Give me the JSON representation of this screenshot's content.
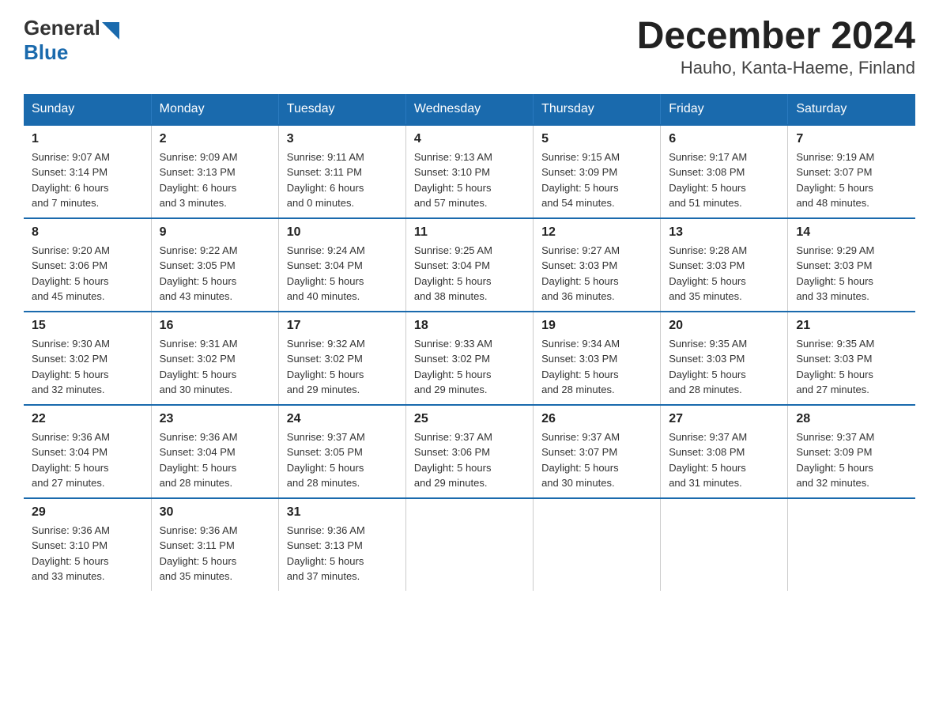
{
  "logo": {
    "general": "General",
    "blue": "Blue"
  },
  "title": "December 2024",
  "subtitle": "Hauho, Kanta-Haeme, Finland",
  "days_of_week": [
    "Sunday",
    "Monday",
    "Tuesday",
    "Wednesday",
    "Thursday",
    "Friday",
    "Saturday"
  ],
  "weeks": [
    [
      {
        "day": "1",
        "sunrise": "9:07 AM",
        "sunset": "3:14 PM",
        "daylight": "6 hours and 7 minutes."
      },
      {
        "day": "2",
        "sunrise": "9:09 AM",
        "sunset": "3:13 PM",
        "daylight": "6 hours and 3 minutes."
      },
      {
        "day": "3",
        "sunrise": "9:11 AM",
        "sunset": "3:11 PM",
        "daylight": "6 hours and 0 minutes."
      },
      {
        "day": "4",
        "sunrise": "9:13 AM",
        "sunset": "3:10 PM",
        "daylight": "5 hours and 57 minutes."
      },
      {
        "day": "5",
        "sunrise": "9:15 AM",
        "sunset": "3:09 PM",
        "daylight": "5 hours and 54 minutes."
      },
      {
        "day": "6",
        "sunrise": "9:17 AM",
        "sunset": "3:08 PM",
        "daylight": "5 hours and 51 minutes."
      },
      {
        "day": "7",
        "sunrise": "9:19 AM",
        "sunset": "3:07 PM",
        "daylight": "5 hours and 48 minutes."
      }
    ],
    [
      {
        "day": "8",
        "sunrise": "9:20 AM",
        "sunset": "3:06 PM",
        "daylight": "5 hours and 45 minutes."
      },
      {
        "day": "9",
        "sunrise": "9:22 AM",
        "sunset": "3:05 PM",
        "daylight": "5 hours and 43 minutes."
      },
      {
        "day": "10",
        "sunrise": "9:24 AM",
        "sunset": "3:04 PM",
        "daylight": "5 hours and 40 minutes."
      },
      {
        "day": "11",
        "sunrise": "9:25 AM",
        "sunset": "3:04 PM",
        "daylight": "5 hours and 38 minutes."
      },
      {
        "day": "12",
        "sunrise": "9:27 AM",
        "sunset": "3:03 PM",
        "daylight": "5 hours and 36 minutes."
      },
      {
        "day": "13",
        "sunrise": "9:28 AM",
        "sunset": "3:03 PM",
        "daylight": "5 hours and 35 minutes."
      },
      {
        "day": "14",
        "sunrise": "9:29 AM",
        "sunset": "3:03 PM",
        "daylight": "5 hours and 33 minutes."
      }
    ],
    [
      {
        "day": "15",
        "sunrise": "9:30 AM",
        "sunset": "3:02 PM",
        "daylight": "5 hours and 32 minutes."
      },
      {
        "day": "16",
        "sunrise": "9:31 AM",
        "sunset": "3:02 PM",
        "daylight": "5 hours and 30 minutes."
      },
      {
        "day": "17",
        "sunrise": "9:32 AM",
        "sunset": "3:02 PM",
        "daylight": "5 hours and 29 minutes."
      },
      {
        "day": "18",
        "sunrise": "9:33 AM",
        "sunset": "3:02 PM",
        "daylight": "5 hours and 29 minutes."
      },
      {
        "day": "19",
        "sunrise": "9:34 AM",
        "sunset": "3:03 PM",
        "daylight": "5 hours and 28 minutes."
      },
      {
        "day": "20",
        "sunrise": "9:35 AM",
        "sunset": "3:03 PM",
        "daylight": "5 hours and 28 minutes."
      },
      {
        "day": "21",
        "sunrise": "9:35 AM",
        "sunset": "3:03 PM",
        "daylight": "5 hours and 27 minutes."
      }
    ],
    [
      {
        "day": "22",
        "sunrise": "9:36 AM",
        "sunset": "3:04 PM",
        "daylight": "5 hours and 27 minutes."
      },
      {
        "day": "23",
        "sunrise": "9:36 AM",
        "sunset": "3:04 PM",
        "daylight": "5 hours and 28 minutes."
      },
      {
        "day": "24",
        "sunrise": "9:37 AM",
        "sunset": "3:05 PM",
        "daylight": "5 hours and 28 minutes."
      },
      {
        "day": "25",
        "sunrise": "9:37 AM",
        "sunset": "3:06 PM",
        "daylight": "5 hours and 29 minutes."
      },
      {
        "day": "26",
        "sunrise": "9:37 AM",
        "sunset": "3:07 PM",
        "daylight": "5 hours and 30 minutes."
      },
      {
        "day": "27",
        "sunrise": "9:37 AM",
        "sunset": "3:08 PM",
        "daylight": "5 hours and 31 minutes."
      },
      {
        "day": "28",
        "sunrise": "9:37 AM",
        "sunset": "3:09 PM",
        "daylight": "5 hours and 32 minutes."
      }
    ],
    [
      {
        "day": "29",
        "sunrise": "9:36 AM",
        "sunset": "3:10 PM",
        "daylight": "5 hours and 33 minutes."
      },
      {
        "day": "30",
        "sunrise": "9:36 AM",
        "sunset": "3:11 PM",
        "daylight": "5 hours and 35 minutes."
      },
      {
        "day": "31",
        "sunrise": "9:36 AM",
        "sunset": "3:13 PM",
        "daylight": "5 hours and 37 minutes."
      },
      {
        "day": "",
        "sunrise": "",
        "sunset": "",
        "daylight": ""
      },
      {
        "day": "",
        "sunrise": "",
        "sunset": "",
        "daylight": ""
      },
      {
        "day": "",
        "sunrise": "",
        "sunset": "",
        "daylight": ""
      },
      {
        "day": "",
        "sunrise": "",
        "sunset": "",
        "daylight": ""
      }
    ]
  ],
  "labels": {
    "sunrise": "Sunrise:",
    "sunset": "Sunset:",
    "daylight": "Daylight:"
  }
}
